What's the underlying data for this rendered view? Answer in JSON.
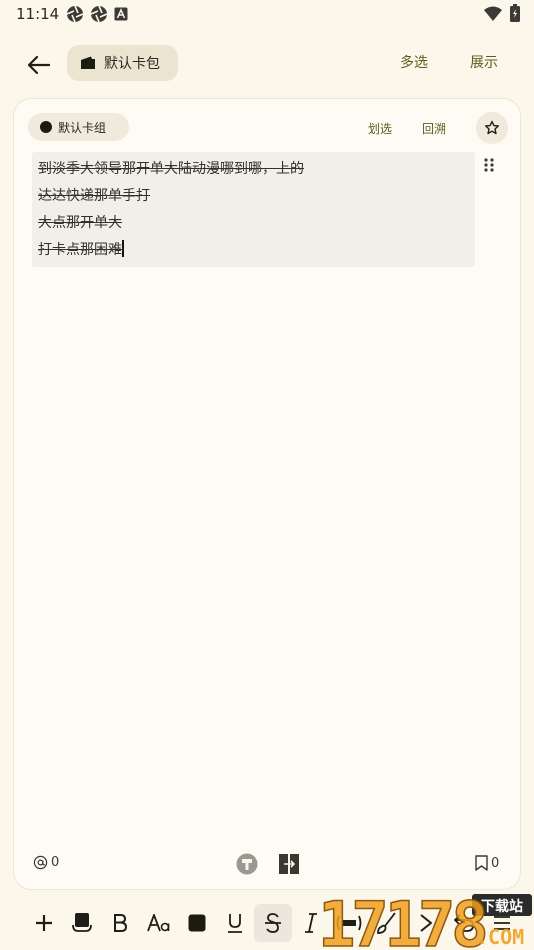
{
  "status_bar": {
    "time": "11:14"
  },
  "app_bar": {
    "wallet_label": "默认卡包",
    "multi_select_label": "多选",
    "show_label": "展示"
  },
  "card": {
    "group_label": "默认卡组",
    "strike_link": "划选",
    "back_link": "回溯",
    "lines": [
      "到淡季大领导那开单大陆动漫哪到哪，上的",
      "达达快递那单手打",
      "大点那开单大",
      "打卡点那困难"
    ],
    "mention_count": "0",
    "bookmark_count": "0"
  },
  "toolbar": {
    "tools": [
      "plus-icon",
      "card-icon",
      "bold-icon",
      "font-size-icon",
      "color-square-icon",
      "underline-icon",
      "strikethrough-icon",
      "italic-icon",
      "highlight-icon",
      "brush-icon",
      "indent-icon",
      "undo-icon",
      "menu-icon"
    ],
    "active": "strikethrough-icon"
  },
  "watermark": {
    "number": "17178",
    "top_text": "下载站",
    "bottom_text": ".COM"
  },
  "colors": {
    "background": "#fbf7ea",
    "accent_text": "#5f5b20",
    "chip": "#ebe4d0"
  }
}
